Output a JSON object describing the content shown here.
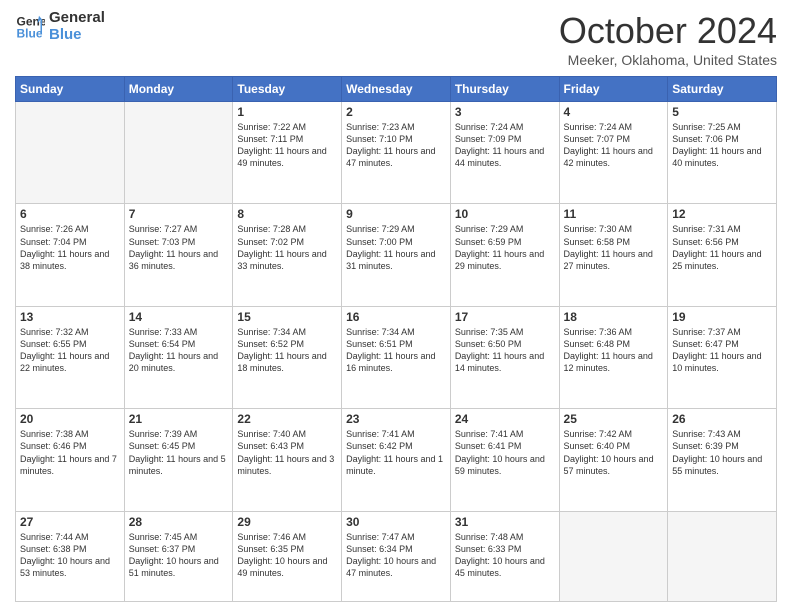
{
  "header": {
    "logo_line1": "General",
    "logo_line2": "Blue",
    "month": "October 2024",
    "location": "Meeker, Oklahoma, United States"
  },
  "days_of_week": [
    "Sunday",
    "Monday",
    "Tuesday",
    "Wednesday",
    "Thursday",
    "Friday",
    "Saturday"
  ],
  "weeks": [
    [
      {
        "day": "",
        "sunrise": "",
        "sunset": "",
        "daylight": "",
        "empty": true
      },
      {
        "day": "",
        "sunrise": "",
        "sunset": "",
        "daylight": "",
        "empty": true
      },
      {
        "day": "1",
        "sunrise": "Sunrise: 7:22 AM",
        "sunset": "Sunset: 7:11 PM",
        "daylight": "Daylight: 11 hours and 49 minutes."
      },
      {
        "day": "2",
        "sunrise": "Sunrise: 7:23 AM",
        "sunset": "Sunset: 7:10 PM",
        "daylight": "Daylight: 11 hours and 47 minutes."
      },
      {
        "day": "3",
        "sunrise": "Sunrise: 7:24 AM",
        "sunset": "Sunset: 7:09 PM",
        "daylight": "Daylight: 11 hours and 44 minutes."
      },
      {
        "day": "4",
        "sunrise": "Sunrise: 7:24 AM",
        "sunset": "Sunset: 7:07 PM",
        "daylight": "Daylight: 11 hours and 42 minutes."
      },
      {
        "day": "5",
        "sunrise": "Sunrise: 7:25 AM",
        "sunset": "Sunset: 7:06 PM",
        "daylight": "Daylight: 11 hours and 40 minutes."
      }
    ],
    [
      {
        "day": "6",
        "sunrise": "Sunrise: 7:26 AM",
        "sunset": "Sunset: 7:04 PM",
        "daylight": "Daylight: 11 hours and 38 minutes."
      },
      {
        "day": "7",
        "sunrise": "Sunrise: 7:27 AM",
        "sunset": "Sunset: 7:03 PM",
        "daylight": "Daylight: 11 hours and 36 minutes."
      },
      {
        "day": "8",
        "sunrise": "Sunrise: 7:28 AM",
        "sunset": "Sunset: 7:02 PM",
        "daylight": "Daylight: 11 hours and 33 minutes."
      },
      {
        "day": "9",
        "sunrise": "Sunrise: 7:29 AM",
        "sunset": "Sunset: 7:00 PM",
        "daylight": "Daylight: 11 hours and 31 minutes."
      },
      {
        "day": "10",
        "sunrise": "Sunrise: 7:29 AM",
        "sunset": "Sunset: 6:59 PM",
        "daylight": "Daylight: 11 hours and 29 minutes."
      },
      {
        "day": "11",
        "sunrise": "Sunrise: 7:30 AM",
        "sunset": "Sunset: 6:58 PM",
        "daylight": "Daylight: 11 hours and 27 minutes."
      },
      {
        "day": "12",
        "sunrise": "Sunrise: 7:31 AM",
        "sunset": "Sunset: 6:56 PM",
        "daylight": "Daylight: 11 hours and 25 minutes."
      }
    ],
    [
      {
        "day": "13",
        "sunrise": "Sunrise: 7:32 AM",
        "sunset": "Sunset: 6:55 PM",
        "daylight": "Daylight: 11 hours and 22 minutes."
      },
      {
        "day": "14",
        "sunrise": "Sunrise: 7:33 AM",
        "sunset": "Sunset: 6:54 PM",
        "daylight": "Daylight: 11 hours and 20 minutes."
      },
      {
        "day": "15",
        "sunrise": "Sunrise: 7:34 AM",
        "sunset": "Sunset: 6:52 PM",
        "daylight": "Daylight: 11 hours and 18 minutes."
      },
      {
        "day": "16",
        "sunrise": "Sunrise: 7:34 AM",
        "sunset": "Sunset: 6:51 PM",
        "daylight": "Daylight: 11 hours and 16 minutes."
      },
      {
        "day": "17",
        "sunrise": "Sunrise: 7:35 AM",
        "sunset": "Sunset: 6:50 PM",
        "daylight": "Daylight: 11 hours and 14 minutes."
      },
      {
        "day": "18",
        "sunrise": "Sunrise: 7:36 AM",
        "sunset": "Sunset: 6:48 PM",
        "daylight": "Daylight: 11 hours and 12 minutes."
      },
      {
        "day": "19",
        "sunrise": "Sunrise: 7:37 AM",
        "sunset": "Sunset: 6:47 PM",
        "daylight": "Daylight: 11 hours and 10 minutes."
      }
    ],
    [
      {
        "day": "20",
        "sunrise": "Sunrise: 7:38 AM",
        "sunset": "Sunset: 6:46 PM",
        "daylight": "Daylight: 11 hours and 7 minutes."
      },
      {
        "day": "21",
        "sunrise": "Sunrise: 7:39 AM",
        "sunset": "Sunset: 6:45 PM",
        "daylight": "Daylight: 11 hours and 5 minutes."
      },
      {
        "day": "22",
        "sunrise": "Sunrise: 7:40 AM",
        "sunset": "Sunset: 6:43 PM",
        "daylight": "Daylight: 11 hours and 3 minutes."
      },
      {
        "day": "23",
        "sunrise": "Sunrise: 7:41 AM",
        "sunset": "Sunset: 6:42 PM",
        "daylight": "Daylight: 11 hours and 1 minute."
      },
      {
        "day": "24",
        "sunrise": "Sunrise: 7:41 AM",
        "sunset": "Sunset: 6:41 PM",
        "daylight": "Daylight: 10 hours and 59 minutes."
      },
      {
        "day": "25",
        "sunrise": "Sunrise: 7:42 AM",
        "sunset": "Sunset: 6:40 PM",
        "daylight": "Daylight: 10 hours and 57 minutes."
      },
      {
        "day": "26",
        "sunrise": "Sunrise: 7:43 AM",
        "sunset": "Sunset: 6:39 PM",
        "daylight": "Daylight: 10 hours and 55 minutes."
      }
    ],
    [
      {
        "day": "27",
        "sunrise": "Sunrise: 7:44 AM",
        "sunset": "Sunset: 6:38 PM",
        "daylight": "Daylight: 10 hours and 53 minutes."
      },
      {
        "day": "28",
        "sunrise": "Sunrise: 7:45 AM",
        "sunset": "Sunset: 6:37 PM",
        "daylight": "Daylight: 10 hours and 51 minutes."
      },
      {
        "day": "29",
        "sunrise": "Sunrise: 7:46 AM",
        "sunset": "Sunset: 6:35 PM",
        "daylight": "Daylight: 10 hours and 49 minutes."
      },
      {
        "day": "30",
        "sunrise": "Sunrise: 7:47 AM",
        "sunset": "Sunset: 6:34 PM",
        "daylight": "Daylight: 10 hours and 47 minutes."
      },
      {
        "day": "31",
        "sunrise": "Sunrise: 7:48 AM",
        "sunset": "Sunset: 6:33 PM",
        "daylight": "Daylight: 10 hours and 45 minutes."
      },
      {
        "day": "",
        "sunrise": "",
        "sunset": "",
        "daylight": "",
        "empty": true
      },
      {
        "day": "",
        "sunrise": "",
        "sunset": "",
        "daylight": "",
        "empty": true
      }
    ]
  ]
}
